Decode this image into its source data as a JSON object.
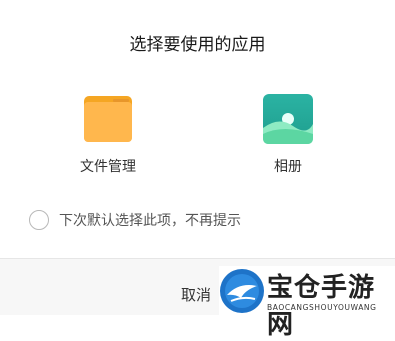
{
  "dialog": {
    "title": "选择要使用的应用",
    "apps": [
      {
        "label": "文件管理",
        "icon": "folder-icon",
        "color": "#FFB74D"
      },
      {
        "label": "相册",
        "icon": "gallery-icon",
        "color": "#26A69A"
      }
    ],
    "remember_label": "下次默认选择此项，不再提示",
    "cancel_label": "取消"
  },
  "watermark": {
    "title": "宝仓手游网",
    "subtitle": "BAOCANGSHOUYOUWANG",
    "accent": "#1E73C8"
  }
}
